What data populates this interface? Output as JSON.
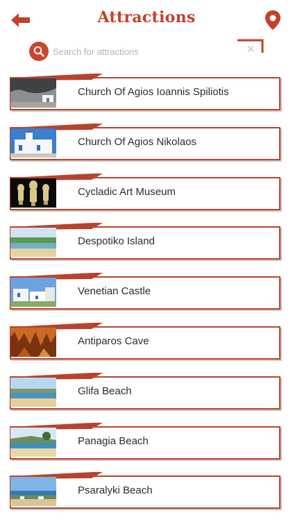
{
  "header": {
    "title": "Attractions",
    "back_icon": "back-arrow-icon",
    "location_icon": "map-pin-icon"
  },
  "search": {
    "placeholder": "Search for attractions",
    "value": "",
    "clear_symbol": "✕"
  },
  "colors": {
    "accent": "#c24128",
    "border": "#b8432c"
  },
  "attractions": [
    {
      "label": "Church Of Agios Ioannis Spiliotis",
      "thumb": "cave-church"
    },
    {
      "label": "Church Of Agios Nikolaos",
      "thumb": "white-church"
    },
    {
      "label": "Cycladic Art Museum",
      "thumb": "figurines"
    },
    {
      "label": "Despotiko Island",
      "thumb": "beach"
    },
    {
      "label": "Venetian Castle",
      "thumb": "village"
    },
    {
      "label": "Antiparos Cave",
      "thumb": "cave"
    },
    {
      "label": "Glifa Beach",
      "thumb": "beach-wide"
    },
    {
      "label": "Panagia Beach",
      "thumb": "bay"
    },
    {
      "label": "Psaralyki Beach",
      "thumb": "shore"
    }
  ]
}
